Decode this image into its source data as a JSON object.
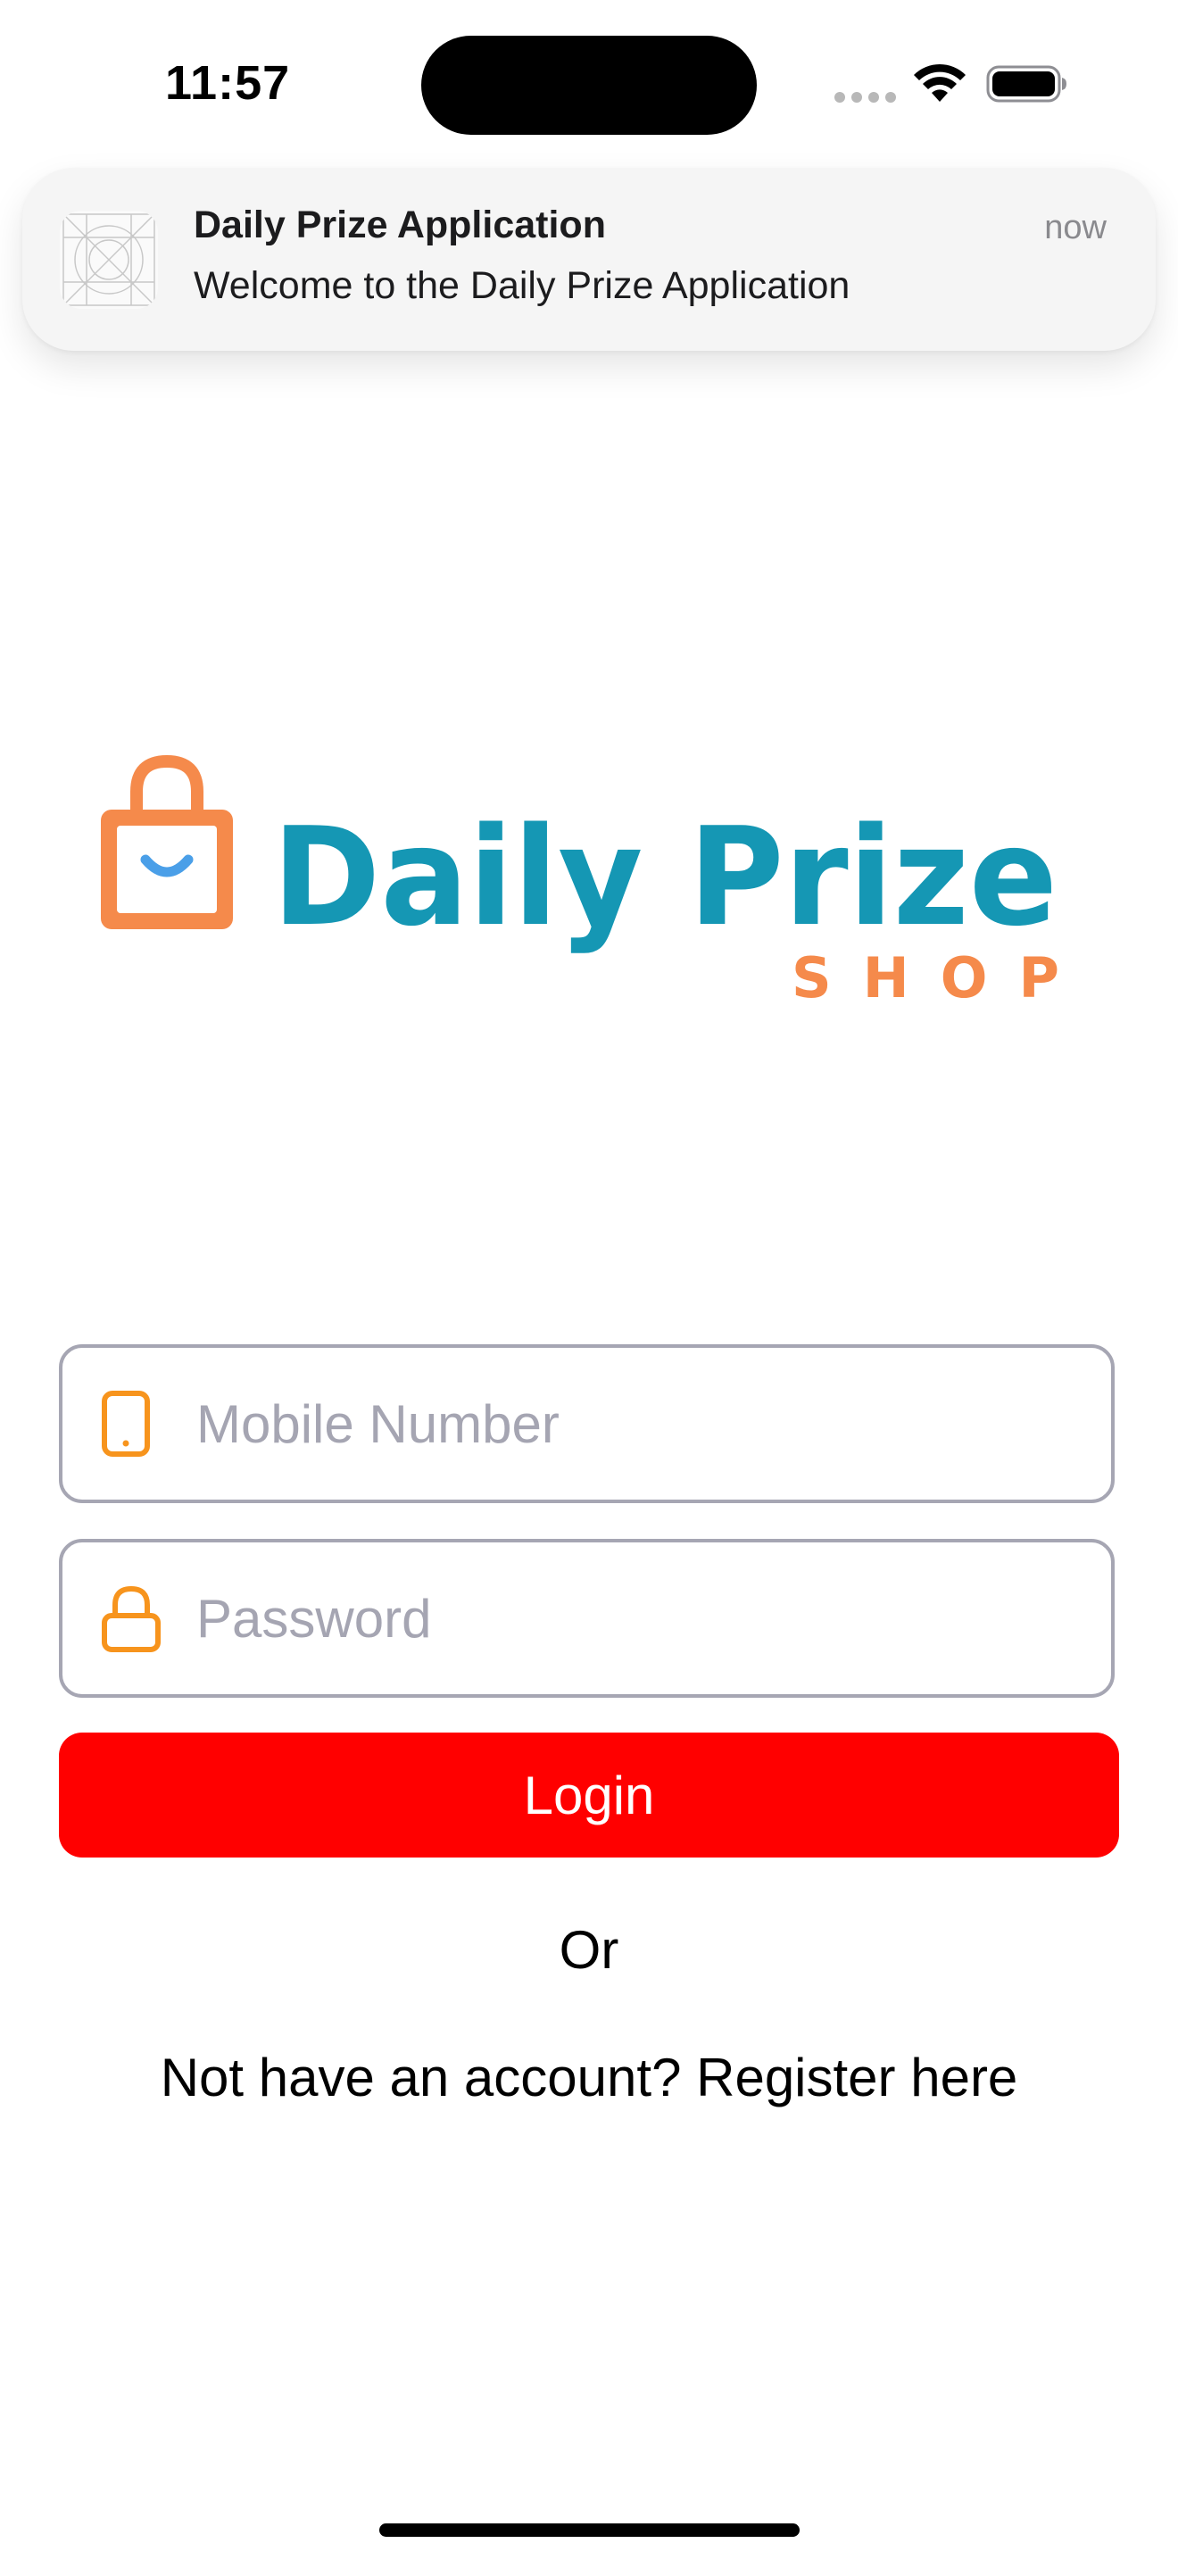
{
  "status_bar": {
    "time": "11:57"
  },
  "notification": {
    "app_name": "Daily Prize Application",
    "message": "Welcome to the Daily Prize Application",
    "time": "now",
    "app_icon": "placeholder-app-icon"
  },
  "logo": {
    "text": "Daily Prize",
    "subtext": "SHOP",
    "icon": "shopping-bag-smile-icon",
    "colors": {
      "primary": "#1597b4",
      "accent": "#f58a4b",
      "smile": "#4a9fe8"
    }
  },
  "form": {
    "mobile": {
      "placeholder": "Mobile Number",
      "value": "",
      "icon": "phone-icon"
    },
    "password": {
      "placeholder": "Password",
      "value": "",
      "icon": "lock-icon"
    },
    "login_label": "Login",
    "or_label": "Or",
    "register_label": "Not have an account? Register here"
  },
  "colors": {
    "login_button": "#ff0000",
    "field_border": "#a6a6b3",
    "icon_orange": "#f7941d",
    "placeholder": "#a5a5b2"
  }
}
